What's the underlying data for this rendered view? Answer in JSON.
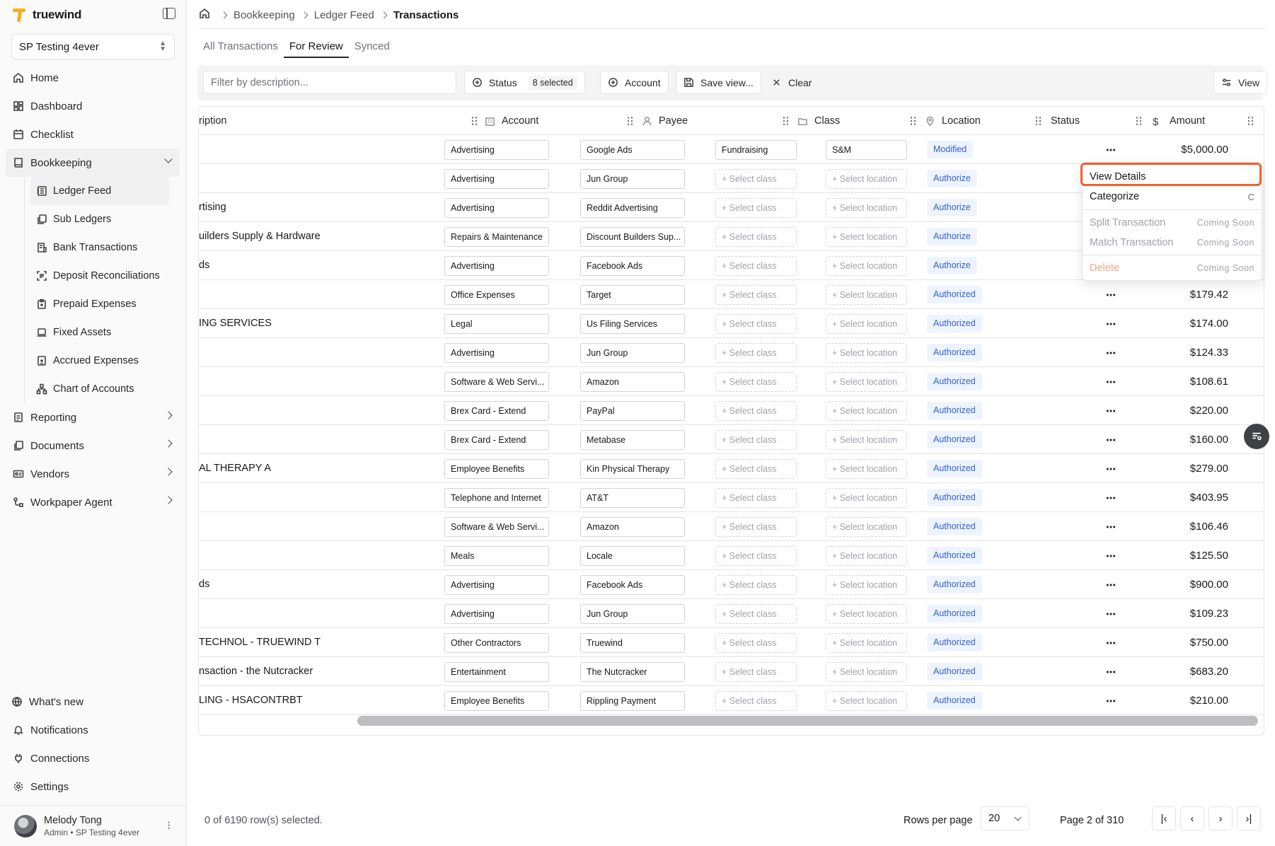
{
  "app": {
    "brand": "truewind",
    "org": "SP Testing 4ever"
  },
  "nav": {
    "home": "Home",
    "dashboard": "Dashboard",
    "checklist": "Checklist",
    "bookkeeping": "Bookkeeping",
    "bookkeeping_items": [
      "Ledger Feed",
      "Sub Ledgers",
      "Bank Transactions",
      "Deposit Reconciliations",
      "Prepaid Expenses",
      "Fixed Assets",
      "Accrued Expenses",
      "Chart of Accounts"
    ],
    "reporting": "Reporting",
    "documents": "Documents",
    "vendors": "Vendors",
    "workpaper": "Workpaper Agent",
    "whats_new": "What's new",
    "notifications": "Notifications",
    "connections": "Connections",
    "settings": "Settings"
  },
  "user": {
    "name": "Melody Tong",
    "role": "Admin • SP Testing 4ever"
  },
  "breadcrumb": [
    "Bookkeeping",
    "Ledger Feed",
    "Transactions"
  ],
  "tabs": [
    "All Transactions",
    "For Review",
    "Synced"
  ],
  "toolbar": {
    "filter_placeholder": "Filter by description...",
    "status_label": "Status",
    "status_count": "8 selected",
    "account_label": "Account",
    "save_view_label": "Save view...",
    "clear_label": "Clear",
    "view_label": "View"
  },
  "columns": {
    "description": "ription",
    "account": "Account",
    "payee": "Payee",
    "class": "Class",
    "location": "Location",
    "status": "Status",
    "amount": "Amount"
  },
  "placeholders": {
    "class": "+ Select class",
    "location": "+ Select location"
  },
  "rows": [
    {
      "desc": "",
      "account": "Advertising",
      "payee": "Google Ads",
      "class": "Fundraising",
      "location": "S&M",
      "status": "Modified",
      "amount": "$5,000.00"
    },
    {
      "desc": "",
      "account": "Advertising",
      "payee": "Jun Group",
      "class": "",
      "location": "",
      "status": "Authorize",
      "amount": ""
    },
    {
      "desc": "rtising",
      "account": "Advertising",
      "payee": "Reddit Advertising",
      "class": "",
      "location": "",
      "status": "Authorize",
      "amount": ""
    },
    {
      "desc": "uilders Supply & Hardware",
      "account": "Repairs & Maintenance",
      "payee": "Discount Builders Sup...",
      "class": "",
      "location": "",
      "status": "Authorize",
      "amount": ""
    },
    {
      "desc": "ds",
      "account": "Advertising",
      "payee": "Facebook Ads",
      "class": "",
      "location": "",
      "status": "Authorize",
      "amount": ""
    },
    {
      "desc": "",
      "account": "Office Expenses",
      "payee": "Target",
      "class": "",
      "location": "",
      "status": "Authorized",
      "amount": "$179.42"
    },
    {
      "desc": "ING SERVICES",
      "account": "Legal",
      "payee": "Us Filing Services",
      "class": "",
      "location": "",
      "status": "Authorized",
      "amount": "$174.00"
    },
    {
      "desc": "",
      "account": "Advertising",
      "payee": "Jun Group",
      "class": "",
      "location": "",
      "status": "Authorized",
      "amount": "$124.33"
    },
    {
      "desc": "",
      "account": "Software & Web Servi...",
      "payee": "Amazon",
      "class": "",
      "location": "",
      "status": "Authorized",
      "amount": "$108.61"
    },
    {
      "desc": "",
      "account": "Brex Card - Extend",
      "payee": "PayPal",
      "class": "",
      "location": "",
      "status": "Authorized",
      "amount": "$220.00"
    },
    {
      "desc": "",
      "account": "Brex Card - Extend",
      "payee": "Metabase",
      "class": "",
      "location": "",
      "status": "Authorized",
      "amount": "$160.00"
    },
    {
      "desc": "AL THERAPY A",
      "account": "Employee Benefits",
      "payee": "Kin Physical Therapy",
      "class": "",
      "location": "",
      "status": "Authorized",
      "amount": "$279.00"
    },
    {
      "desc": "",
      "account": "Telephone and Internet",
      "payee": "AT&T",
      "class": "",
      "location": "",
      "status": "Authorized",
      "amount": "$403.95"
    },
    {
      "desc": "",
      "account": "Software & Web Servi...",
      "payee": "Amazon",
      "class": "",
      "location": "",
      "status": "Authorized",
      "amount": "$106.46"
    },
    {
      "desc": "",
      "account": "Meals",
      "payee": "Locale",
      "class": "",
      "location": "",
      "status": "Authorized",
      "amount": "$125.50"
    },
    {
      "desc": "ds",
      "account": "Advertising",
      "payee": "Facebook Ads",
      "class": "",
      "location": "",
      "status": "Authorized",
      "amount": "$900.00"
    },
    {
      "desc": "",
      "account": "Advertising",
      "payee": "Jun Group",
      "class": "",
      "location": "",
      "status": "Authorized",
      "amount": "$109.23"
    },
    {
      "desc": "TECHNOL - TRUEWIND T",
      "account": "Other Contractors",
      "payee": "Truewind",
      "class": "",
      "location": "",
      "status": "Authorized",
      "amount": "$750.00"
    },
    {
      "desc": "nsaction - the Nutcracker",
      "account": "Entertainment",
      "payee": "The Nutcracker",
      "class": "",
      "location": "",
      "status": "Authorized",
      "amount": "$683.20"
    },
    {
      "desc": "LING - HSACONTRBT",
      "account": "Employee Benefits",
      "payee": "Rippling Payment",
      "class": "",
      "location": "",
      "status": "Authorized",
      "amount": "$210.00"
    }
  ],
  "menu": {
    "view_details": "View Details",
    "categorize": "Categorize",
    "categorize_shortcut": "C",
    "split": "Split Transaction",
    "match": "Match Transaction",
    "delete": "Delete",
    "coming_soon": "Coming Soon"
  },
  "footer": {
    "selected": "0 of 6190 row(s) selected.",
    "rows_per_page_label": "Rows per page",
    "rows_per_page": "20",
    "page": "Page 2 of 310"
  },
  "colors": {
    "brand": "#f5b021",
    "status_blue": "#2f5fd0",
    "highlight": "#f0612e"
  }
}
